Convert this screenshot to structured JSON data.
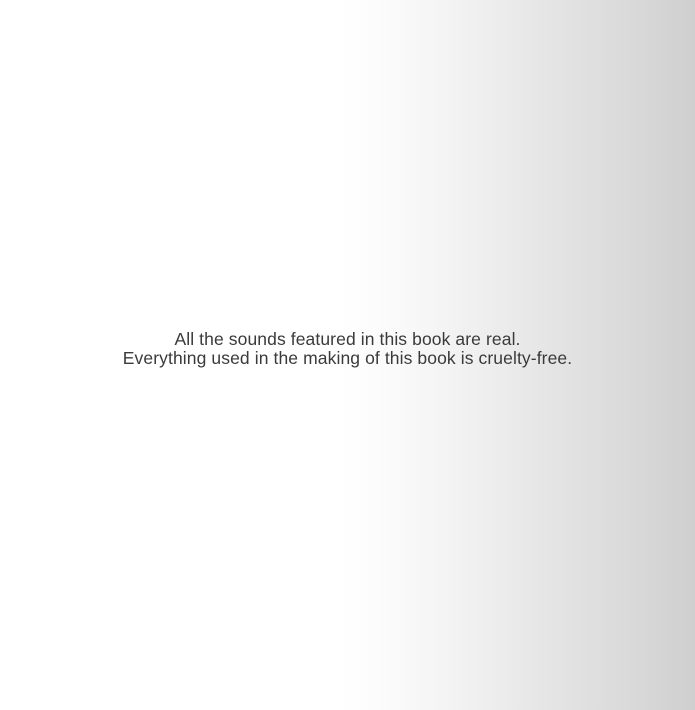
{
  "page": {
    "background_gradient": [
      "#ffffff",
      "#cfcfcf"
    ],
    "text_color": "#3a3a3a"
  },
  "notice": {
    "line1": "All the sounds featured in this book are real.",
    "line2": "Everything used in the making of this book is cruelty-free."
  }
}
